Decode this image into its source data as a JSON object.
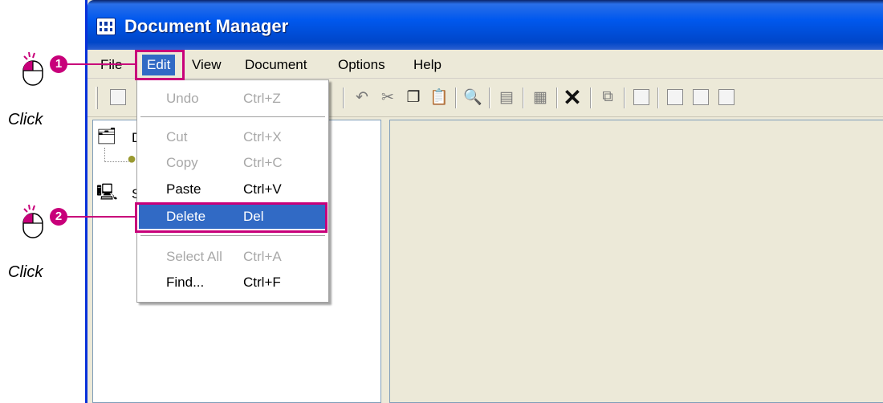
{
  "window": {
    "title": "Document Manager"
  },
  "menubar": {
    "items": [
      {
        "label": "File"
      },
      {
        "label": "Edit"
      },
      {
        "label": "View"
      },
      {
        "label": "Document"
      },
      {
        "label": "Options"
      },
      {
        "label": "Help"
      }
    ]
  },
  "edit_menu": {
    "undo": {
      "label": "Undo",
      "shortcut": "Ctrl+Z"
    },
    "cut": {
      "label": "Cut",
      "shortcut": "Ctrl+X"
    },
    "copy": {
      "label": "Copy",
      "shortcut": "Ctrl+C"
    },
    "paste": {
      "label": "Paste",
      "shortcut": "Ctrl+V"
    },
    "delete": {
      "label": "Delete",
      "shortcut": "Del"
    },
    "select_all": {
      "label": "Select All",
      "shortcut": "Ctrl+A"
    },
    "find": {
      "label": "Find...",
      "shortcut": "Ctrl+F"
    }
  },
  "tree": {
    "item1_initial": "D",
    "item2_initial": "S"
  },
  "annotations": {
    "step1": {
      "number": "1",
      "label": "Click"
    },
    "step2": {
      "number": "2",
      "label": "Click"
    }
  },
  "colors": {
    "accent": "#c8007a",
    "selection": "#316ac5",
    "titlebar": "#0058ee"
  }
}
